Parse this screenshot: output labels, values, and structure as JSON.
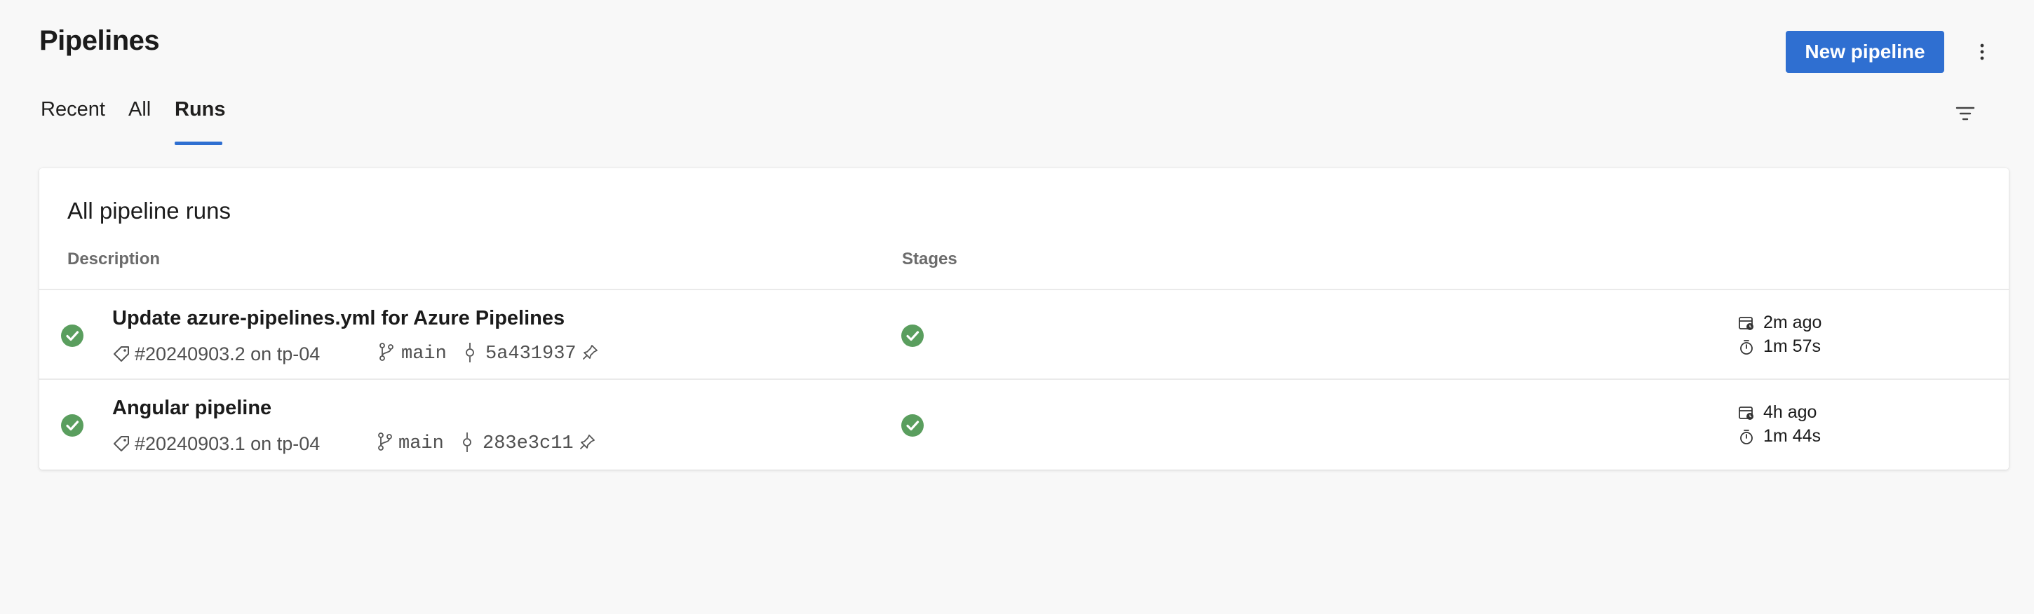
{
  "header": {
    "title": "Pipelines",
    "new_button_label": "New pipeline"
  },
  "tabs": [
    {
      "label": "Recent",
      "selected": false
    },
    {
      "label": "All",
      "selected": false
    },
    {
      "label": "Runs",
      "selected": true
    }
  ],
  "card": {
    "title": "All pipeline runs",
    "columns": {
      "description": "Description",
      "stages": "Stages"
    }
  },
  "runs": [
    {
      "status": "succeeded",
      "title": "Update azure-pipelines.yml for Azure Pipelines",
      "run_id": "#20240903.2 on tp-04",
      "branch": "main",
      "commit": "5a431937",
      "stage_status": "succeeded",
      "started": "2m ago",
      "duration": "1m 57s"
    },
    {
      "status": "succeeded",
      "title": "Angular pipeline",
      "run_id": "#20240903.1 on tp-04",
      "branch": "main",
      "commit": "283e3c11",
      "stage_status": "succeeded",
      "started": "4h ago",
      "duration": "1m 44s"
    }
  ],
  "icons": {
    "success": "check-circle",
    "tag": "tag-icon",
    "branch": "branch-icon",
    "commit": "commit-icon",
    "pin": "pin-icon",
    "calendar": "calendar-clock-icon",
    "stopwatch": "stopwatch-icon"
  },
  "colors": {
    "accent": "#2f6fd1",
    "success": "#5a9e5e",
    "background": "#f8f8f8",
    "card": "#ffffff"
  }
}
